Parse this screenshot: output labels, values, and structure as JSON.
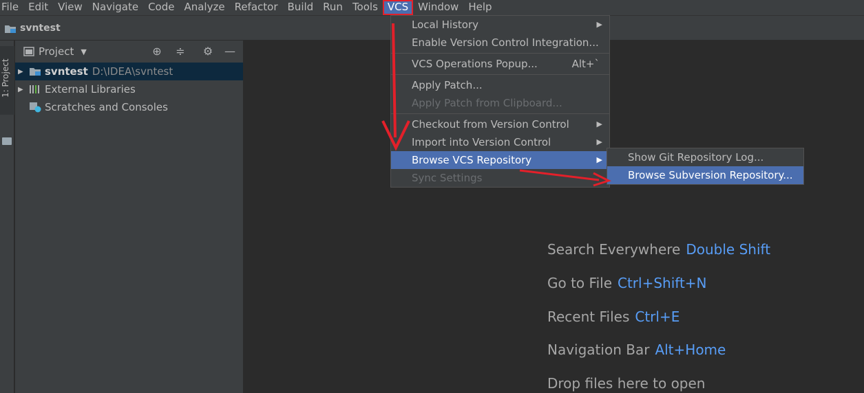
{
  "menubar": {
    "items": [
      "File",
      "Edit",
      "View",
      "Navigate",
      "Code",
      "Analyze",
      "Refactor",
      "Build",
      "Run",
      "Tools",
      "VCS",
      "Window",
      "Help"
    ]
  },
  "navbar": {
    "project_name": "svntest"
  },
  "toolstrip": {
    "project_tab_label": "1: Project"
  },
  "project_panel": {
    "title": "Project",
    "tree": [
      {
        "label": "svntest",
        "path": "D:\\IDEA\\svntest",
        "selected": true
      },
      {
        "label": "External Libraries"
      },
      {
        "label": "Scratches and Consoles"
      }
    ]
  },
  "editor_hints": [
    {
      "label": "Search Everywhere",
      "shortcut": "Double Shift"
    },
    {
      "label": "Go to File",
      "shortcut": "Ctrl+Shift+N"
    },
    {
      "label": "Recent Files",
      "shortcut": "Ctrl+E"
    },
    {
      "label": "Navigation Bar",
      "shortcut": "Alt+Home"
    },
    {
      "label": "Drop files here to open",
      "shortcut": ""
    }
  ],
  "vcs_menu": {
    "items": [
      {
        "label": "Local History",
        "submenu": true
      },
      {
        "label": "Enable Version Control Integration..."
      },
      {
        "label": "VCS Operations Popup...",
        "shortcut": "Alt+`"
      },
      {
        "label": "Apply Patch..."
      },
      {
        "label": "Apply Patch from Clipboard...",
        "disabled": true
      },
      {
        "label": "Checkout from Version Control",
        "submenu": true
      },
      {
        "label": "Import into Version Control",
        "submenu": true
      },
      {
        "label": "Browse VCS Repository",
        "submenu": true,
        "selected": true
      },
      {
        "label": "Sync Settings",
        "disabled": true
      }
    ]
  },
  "browse_submenu": {
    "items": [
      {
        "label": "Show Git Repository Log..."
      },
      {
        "label": "Browse Subversion Repository...",
        "selected": true
      }
    ]
  },
  "colors": {
    "accent": "#4b6eaf",
    "annotation": "#e3202a",
    "shortcut_key": "#589df6"
  }
}
